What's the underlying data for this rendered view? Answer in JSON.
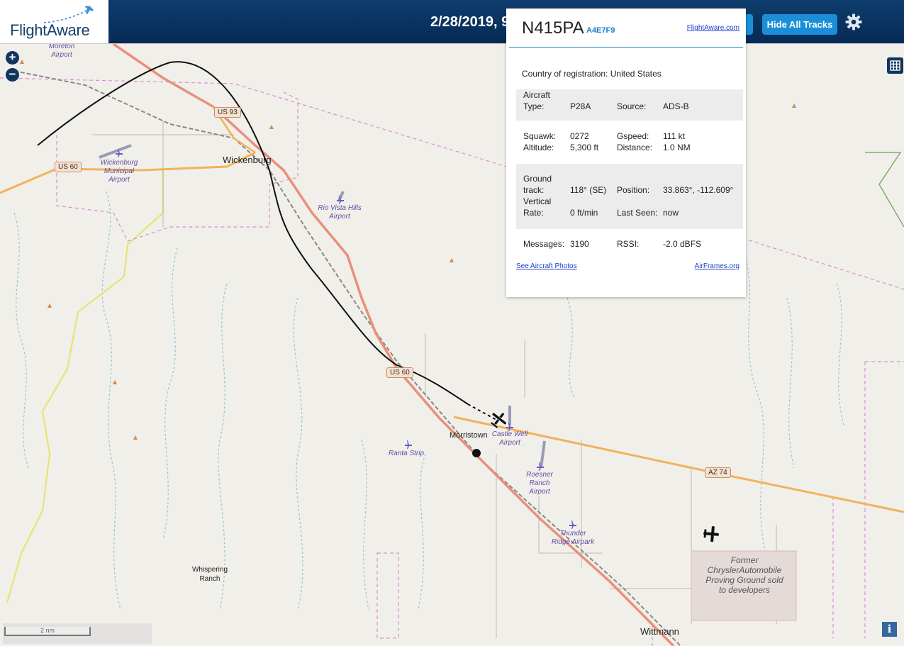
{
  "header": {
    "logo_text": "FlightAware",
    "date_text": "2/28/2019, 9",
    "hide_tracks_label": "Hide All Tracks",
    "settings_icon": "gear-icon"
  },
  "map": {
    "zoom_in": "+",
    "zoom_out": "−",
    "info_label": "i",
    "scale_label": "2 nm",
    "towns": [
      {
        "id": "wickenburg",
        "label": "Wickenburg"
      },
      {
        "id": "morristown",
        "label": "Morristown"
      },
      {
        "id": "wittmann",
        "label": "Wittmann"
      },
      {
        "id": "whispering",
        "label": "Whispering Ranch"
      }
    ],
    "airports": [
      {
        "id": "moreton",
        "label": "Moreton Airport"
      },
      {
        "id": "wickenburg-muni",
        "label": "Wickenburg Municipal Airport"
      },
      {
        "id": "rio-vista",
        "label": "Rio Vista Hills Airport"
      },
      {
        "id": "castle-well",
        "label": "Castle Well Airport"
      },
      {
        "id": "ranta",
        "label": "Ranta Strip"
      },
      {
        "id": "roesner",
        "label": "Roesner Ranch Airport"
      },
      {
        "id": "thunder-ridge",
        "label": "Thunder Ridge Airpark"
      }
    ],
    "proving_ground": "Former ChryslerAutomobile Proving Ground sold to developers",
    "shields": {
      "us93": "US 93",
      "us60a": "US 60",
      "us60b": "US 60",
      "az74": "AZ 74"
    },
    "colors": {
      "highway": "#e8907a",
      "major_road": "#f3b25a",
      "boundary": "#d58fd6",
      "water": "#8fc4d6",
      "track": "#111111",
      "land": "#f1efe9"
    }
  },
  "popup": {
    "ident": "N415PA",
    "hex": "A4E7F9",
    "fa_link": "FlightAware.com",
    "country_label": "Country of registration:",
    "country_value": "United States",
    "aircraft_type_label": "Aircraft Type:",
    "aircraft_type": "P28A",
    "source_label": "Source:",
    "source": "ADS-B",
    "squawk_label": "Squawk:",
    "squawk": "0272",
    "gspeed_label": "Gspeed:",
    "gspeed": "111 kt",
    "altitude_label": "Altitude:",
    "altitude": "5,300 ft",
    "distance_label": "Distance:",
    "distance": "1.0 NM",
    "ground_track_label": "Ground track:",
    "ground_track": "118° (SE)",
    "position_label": "Position:",
    "position": "33.863°, -112.609°",
    "vertical_rate_label": "Vertical Rate:",
    "vertical_rate": "0 ft/min",
    "last_seen_label": "Last Seen:",
    "last_seen": "now",
    "messages_label": "Messages:",
    "messages": "3190",
    "rssi_label": "RSSI:",
    "rssi": "-2.0 dBFS",
    "photos_link": "See Aircraft Photos",
    "airframes_link": "AirFrames.org"
  }
}
